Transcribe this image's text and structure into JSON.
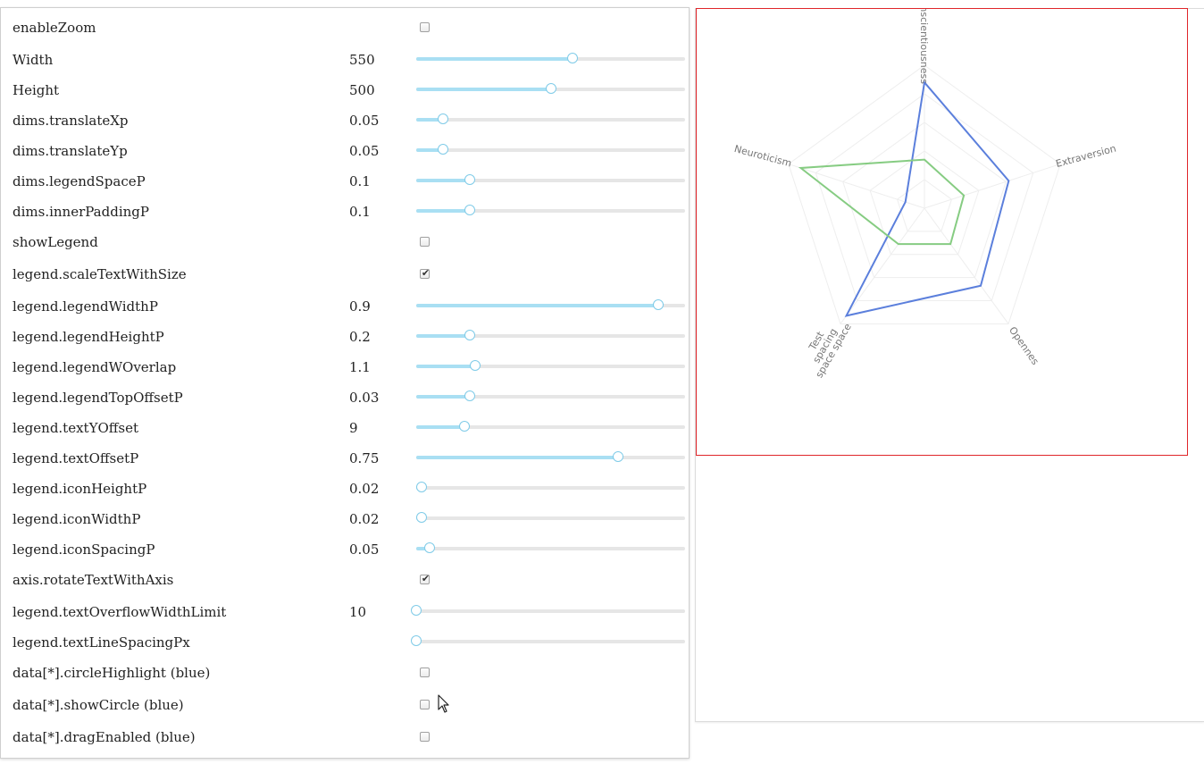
{
  "controls": [
    {
      "label": "enableZoom",
      "kind": "checkbox",
      "checked": false
    },
    {
      "label": "Width",
      "kind": "slider",
      "value": "550",
      "fraction": 0.58
    },
    {
      "label": "Height",
      "kind": "slider",
      "value": "500",
      "fraction": 0.5
    },
    {
      "label": "dims.translateXp",
      "kind": "slider",
      "value": "0.05",
      "fraction": 0.1
    },
    {
      "label": "dims.translateYp",
      "kind": "slider",
      "value": "0.05",
      "fraction": 0.1
    },
    {
      "label": "dims.legendSpaceP",
      "kind": "slider",
      "value": "0.1",
      "fraction": 0.2
    },
    {
      "label": "dims.innerPaddingP",
      "kind": "slider",
      "value": "0.1",
      "fraction": 0.2
    },
    {
      "label": "showLegend",
      "kind": "checkbox",
      "checked": false
    },
    {
      "label": "legend.scaleTextWithSize",
      "kind": "checkbox",
      "checked": true
    },
    {
      "label": "legend.legendWidthP",
      "kind": "slider",
      "value": "0.9",
      "fraction": 0.9
    },
    {
      "label": "legend.legendHeightP",
      "kind": "slider",
      "value": "0.2",
      "fraction": 0.2
    },
    {
      "label": "legend.legendWOverlap",
      "kind": "slider",
      "value": "1.1",
      "fraction": 0.22
    },
    {
      "label": "legend.legendTopOffsetP",
      "kind": "slider",
      "value": "0.03",
      "fraction": 0.2
    },
    {
      "label": "legend.textYOffset",
      "kind": "slider",
      "value": "9",
      "fraction": 0.18
    },
    {
      "label": "legend.textOffsetP",
      "kind": "slider",
      "value": "0.75",
      "fraction": 0.75
    },
    {
      "label": "legend.iconHeightP",
      "kind": "slider",
      "value": "0.02",
      "fraction": 0.02
    },
    {
      "label": "legend.iconWidthP",
      "kind": "slider",
      "value": "0.02",
      "fraction": 0.02
    },
    {
      "label": "legend.iconSpacingP",
      "kind": "slider",
      "value": "0.05",
      "fraction": 0.05
    },
    {
      "label": "axis.rotateTextWithAxis",
      "kind": "checkbox",
      "checked": true
    },
    {
      "label": "legend.textOverflowWidthLimit",
      "kind": "slider",
      "value": "10",
      "fraction": 0.0
    },
    {
      "label": "legend.textLineSpacingPx",
      "kind": "slider",
      "value": "",
      "fraction": 0.0
    },
    {
      "label": "data[*].circleHighlight (blue)",
      "kind": "checkbox",
      "checked": false
    },
    {
      "label": "data[*].showCircle (blue)",
      "kind": "checkbox",
      "checked": false
    },
    {
      "label": "data[*].dragEnabled (blue)",
      "kind": "checkbox",
      "checked": false
    }
  ],
  "icons": {
    "checkmark": "✔",
    "cursor": "mouse-pointer-icon"
  },
  "colors": {
    "frame_border": "#e0262a",
    "blue_series": "#5b7fdc",
    "green_series": "#86cc82",
    "slider_fill": "#a9dff3",
    "slider_thumb": "#7fcbe8"
  },
  "chart_data": {
    "type": "radar",
    "axes": [
      "Conscientiousness",
      "Extraversion",
      "Opennes",
      "Test spacing space space",
      "Neuroticism"
    ],
    "axis_label_lines": [
      [
        "Conscientiousness"
      ],
      [
        "Extraversion"
      ],
      [
        "Opennes"
      ],
      [
        "Test",
        "spacing",
        "space space"
      ],
      [
        "Neuroticism"
      ]
    ],
    "max": 1,
    "levels": 5,
    "grid": true,
    "legend": false,
    "series": [
      {
        "color": "#5b7fdc",
        "values": [
          0.88,
          0.62,
          0.67,
          0.93,
          0.14
        ]
      },
      {
        "color": "#86cc82",
        "values": [
          0.34,
          0.29,
          0.31,
          0.31,
          0.91
        ]
      }
    ]
  }
}
